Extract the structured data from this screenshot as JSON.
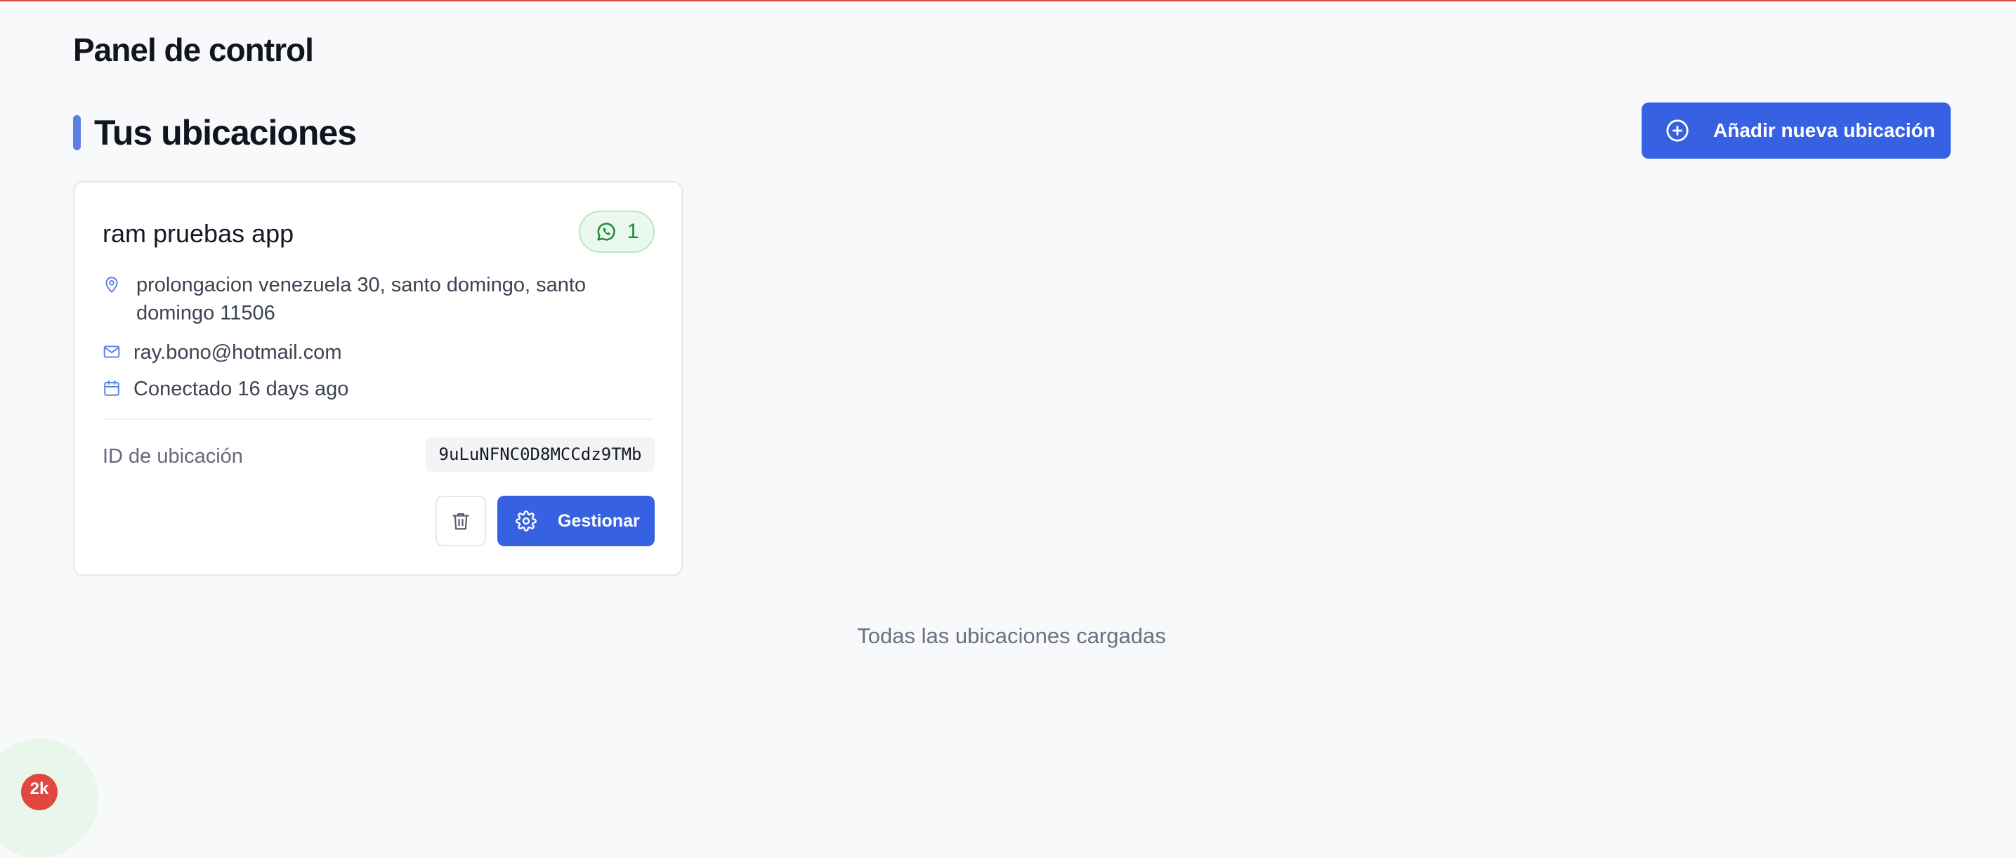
{
  "page": {
    "title": "Panel de control"
  },
  "locations_section": {
    "title": "Tus ubicaciones",
    "add_button_label": "Añadir nueva ubicación"
  },
  "location_card": {
    "name": "ram pruebas app",
    "whatsapp_count": "1",
    "address_line1": "prolongacion venezuela 30, santo domingo, santo",
    "address_line2": "domingo 11506",
    "email": "ray.bono@hotmail.com",
    "connected": "Conectado 16 days ago",
    "id_label": "ID de ubicación",
    "id_value": "9uLuNFNC0D8MCCdz9TMb",
    "manage_label": "Gestionar"
  },
  "footer": {
    "status_text": "Todas las ubicaciones cargadas"
  },
  "widget": {
    "badge_text": "2k"
  },
  "colors": {
    "primary": "#3661e3",
    "accent_bar": "#5a7fe6",
    "whatsapp_green": "#1e8a3c",
    "top_line": "#e04b4b"
  },
  "icons": {
    "add": "plus-circle-icon",
    "whatsapp": "whatsapp-icon",
    "address": "map-pin-icon",
    "email": "mail-icon",
    "connected": "calendar-icon",
    "delete": "trash-icon",
    "manage": "gear-icon"
  }
}
